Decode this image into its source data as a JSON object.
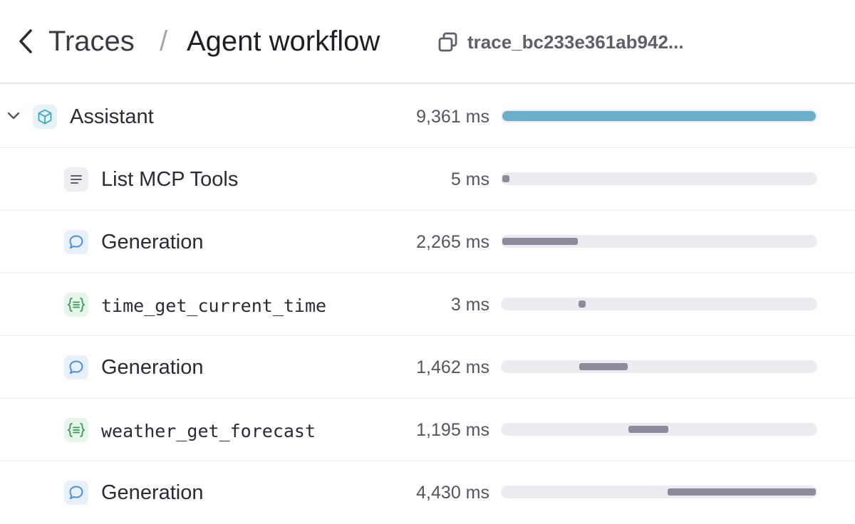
{
  "header": {
    "back_icon": "chevron-left-icon",
    "breadcrumb_parent": "Traces",
    "separator": "/",
    "title": "Agent workflow",
    "copy_icon": "copy-icon",
    "trace_id": "trace_bc233e361ab942..."
  },
  "colors": {
    "root_bar": "#69afc9",
    "span_bar": "#8c8b9c",
    "track": "#ebebf0",
    "agent_icon": "#3aa6c2",
    "generation_icon": "#4f8ee8",
    "function_icon": "#3a9b55"
  },
  "trace_total_ms": 9361,
  "spans": [
    {
      "label": "Assistant",
      "duration": "9,361 ms",
      "type": "agent",
      "icon": "cube-icon",
      "expanded": true,
      "start_fraction": 0.0,
      "length_fraction": 1.0
    },
    {
      "label": "List MCP Tools",
      "duration": "5 ms",
      "type": "list",
      "icon": "list-icon",
      "start_fraction": 0.0,
      "length_fraction": 0.0005
    },
    {
      "label": "Generation",
      "duration": "2,265 ms",
      "type": "generation",
      "icon": "chat-bubble-icon",
      "start_fraction": 0.0,
      "length_fraction": 0.242
    },
    {
      "label": "time_get_current_time",
      "duration": "3 ms",
      "type": "function",
      "icon": "function-braces-icon",
      "start_fraction": 0.243,
      "length_fraction": 0.0003
    },
    {
      "label": "Generation",
      "duration": "1,462 ms",
      "type": "generation",
      "icon": "chat-bubble-icon",
      "start_fraction": 0.245,
      "length_fraction": 0.156
    },
    {
      "label": "weather_get_forecast",
      "duration": "1,195 ms",
      "type": "function",
      "icon": "function-braces-icon",
      "start_fraction": 0.402,
      "length_fraction": 0.128
    },
    {
      "label": "Generation",
      "duration": "4,430 ms",
      "type": "generation",
      "icon": "chat-bubble-icon",
      "start_fraction": 0.527,
      "length_fraction": 0.473
    }
  ]
}
